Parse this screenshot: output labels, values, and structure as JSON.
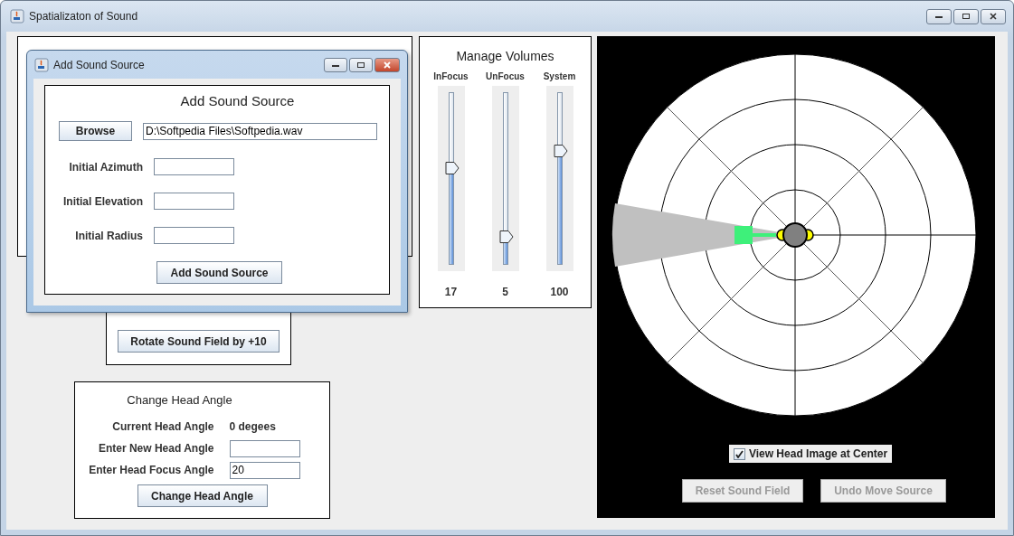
{
  "window": {
    "title": "Spatializaton of Sound"
  },
  "dialog": {
    "title": "Add Sound Source",
    "heading": "Add Sound Source",
    "browse_button": "Browse",
    "file_path": "D:\\Softpedia Files\\Softpedia.wav",
    "fields": [
      {
        "label": "Initial Azimuth"
      },
      {
        "label": "Initial Elevation"
      },
      {
        "label": "Initial Radius"
      }
    ],
    "add_button": "Add Sound Source"
  },
  "rotate_panel": {
    "button": "Rotate Sound Field by +10"
  },
  "head_panel": {
    "title": "Change Head Angle",
    "current_label": "Current Head Angle",
    "current_value": "0 degees",
    "fields": [
      {
        "label": "Enter New Head Angle"
      },
      {
        "label": "Enter Head Focus Angle",
        "value": "20"
      }
    ],
    "button": "Change Head Angle"
  },
  "volumes": {
    "title": "Manage Volumes",
    "sliders": [
      {
        "label": "InFocus",
        "level": 0.56,
        "reading": "17"
      },
      {
        "label": "UnFocus",
        "level": 0.16,
        "reading": "5"
      },
      {
        "label": "System",
        "level": 0.66,
        "reading": "100"
      }
    ]
  },
  "sound_field": {
    "checkbox": {
      "label": "View Head Image at Center",
      "checked": true
    },
    "buttons": [
      {
        "label": "Reset Sound Field",
        "disabled": true
      },
      {
        "label": "Undo Move Source",
        "disabled": true
      }
    ]
  }
}
